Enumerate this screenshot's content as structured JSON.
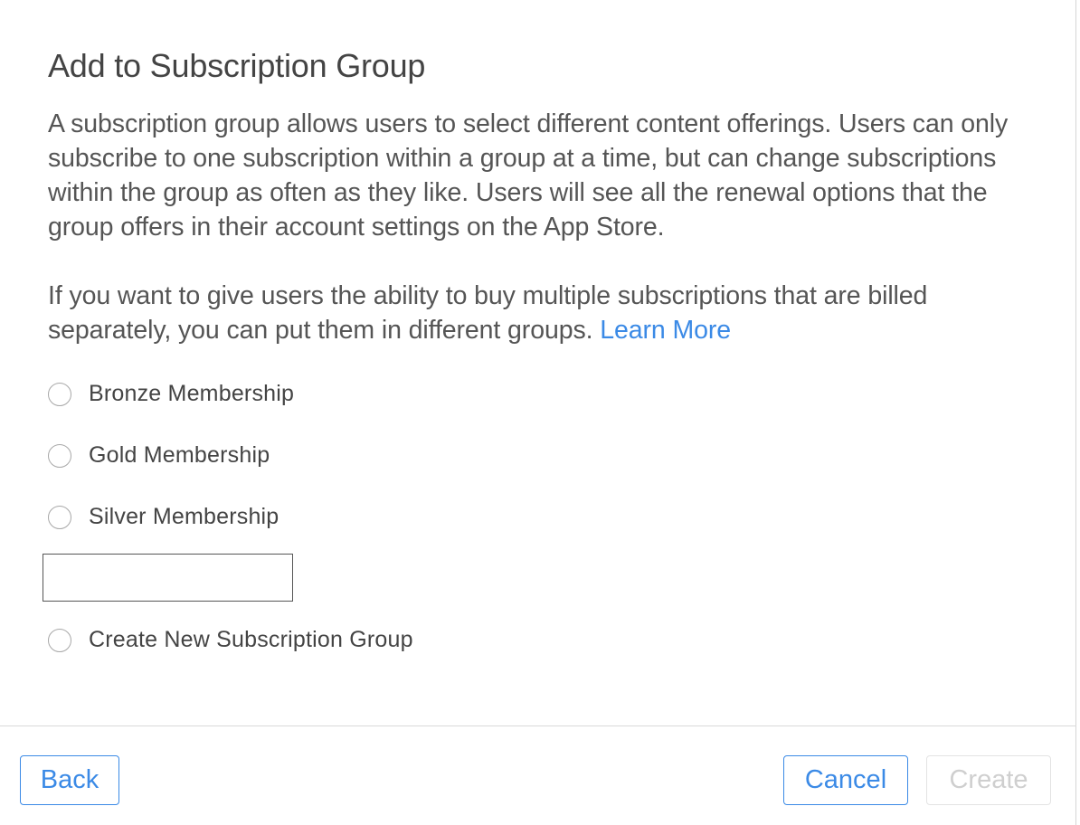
{
  "dialog": {
    "title": "Add to Subscription Group",
    "description_1": "A subscription group allows users to select different content offerings. Users can only subscribe to one subscription within a group at a time, but can change subscriptions within the group as often as they like. Users will see all the renewal options that the group offers in their account settings on the App Store.",
    "description_2": "If you want to give users the ability to buy multiple subscriptions that are billed separately, you can put them in different groups.",
    "learn_more_link": "Learn More",
    "options": [
      {
        "label": "Bronze Membership",
        "selected": false
      },
      {
        "label": "Gold Membership",
        "selected": false
      },
      {
        "label": "Silver Membership",
        "selected": false
      },
      {
        "label": "Create New Subscription Group",
        "selected": false
      }
    ],
    "new_group_name": {
      "value": "",
      "placeholder": ""
    }
  },
  "footer": {
    "back_label": "Back",
    "cancel_label": "Cancel",
    "create_label": "Create",
    "create_enabled": false
  },
  "colors": {
    "link": "#3b8ae6",
    "text": "#444444",
    "disabled": "#cfcfcf"
  }
}
